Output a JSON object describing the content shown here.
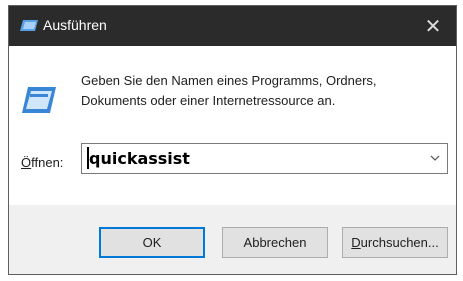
{
  "window": {
    "title": "Ausführen",
    "close_glyph": "✕"
  },
  "content": {
    "description": "Geben Sie den Namen eines Programms, Ordners, Dokuments oder einer Internetressource an.",
    "open_label_first": "Ö",
    "open_label_rest": "ffnen:",
    "input_value": "quickassist"
  },
  "buttons": {
    "ok": "OK",
    "cancel": "Abbrechen",
    "browse_first": "D",
    "browse_rest": "urchsuchen..."
  },
  "icons": {
    "title_icon": "run-icon",
    "dialog_icon": "run-icon",
    "dropdown": "chevron-down-icon"
  },
  "colors": {
    "titlebar": "#2b2b2b",
    "footer": "#f0f0f0",
    "button": "#e1e1e1",
    "focus_border": "#0078d7"
  }
}
